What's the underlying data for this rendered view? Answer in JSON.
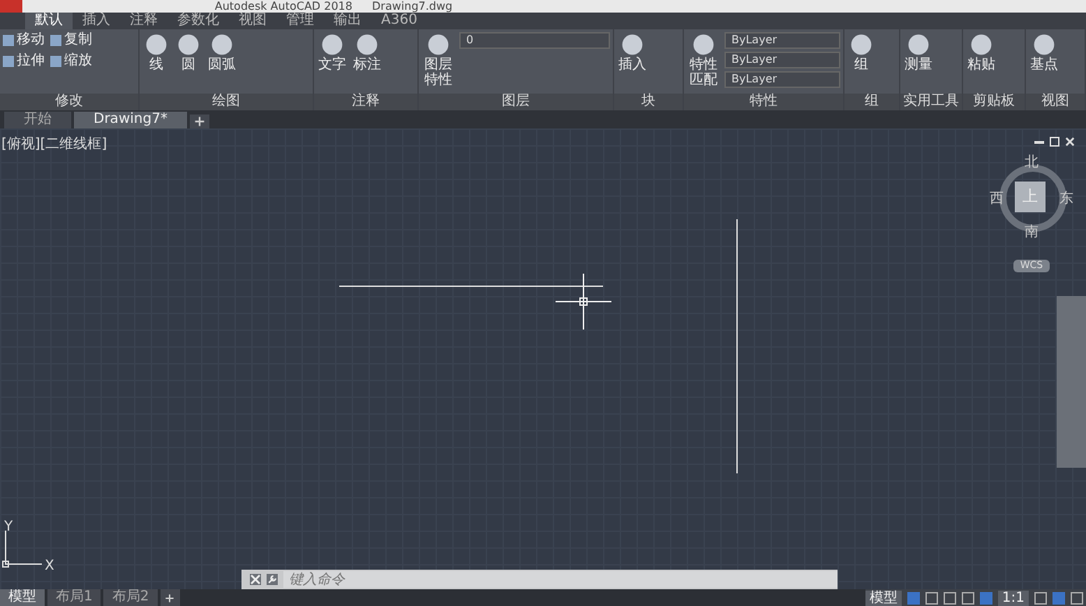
{
  "window": {
    "title": "Autodesk AutoCAD 2018",
    "document": "Drawing7.dwg"
  },
  "ribbon_tabs": [
    {
      "label": "默认",
      "selected": true
    },
    {
      "label": "插入",
      "selected": false
    },
    {
      "label": "注释",
      "selected": false
    },
    {
      "label": "参数化",
      "selected": false
    },
    {
      "label": "视图",
      "selected": false
    },
    {
      "label": "管理",
      "selected": false
    },
    {
      "label": "输出",
      "selected": false
    },
    {
      "label": "A360",
      "selected": false
    }
  ],
  "ribbon_panels": [
    {
      "title": "修改",
      "tools": [
        {
          "kind": "small",
          "label": "移动"
        },
        {
          "kind": "small",
          "label": "复制"
        },
        {
          "kind": "small",
          "label": "拉伸"
        },
        {
          "kind": "small",
          "label": "缩放"
        }
      ]
    },
    {
      "title": "绘图",
      "tools": [
        {
          "kind": "large",
          "label": "线"
        },
        {
          "kind": "large",
          "label": "圆"
        },
        {
          "kind": "large",
          "label": "圆弧"
        }
      ]
    },
    {
      "title": "注释",
      "tools": [
        {
          "kind": "large",
          "label": "文字"
        },
        {
          "kind": "large",
          "label": "标注"
        }
      ]
    },
    {
      "title": "图层",
      "tools": [
        {
          "kind": "large",
          "label": "图层特性"
        },
        {
          "kind": "dropdown",
          "label": "0"
        }
      ]
    },
    {
      "title": "块",
      "tools": [
        {
          "kind": "large",
          "label": "插入"
        }
      ]
    },
    {
      "title": "特性",
      "tools": [
        {
          "kind": "large",
          "label": "特性匹配"
        },
        {
          "kind": "dropdown",
          "label": "ByLayer"
        },
        {
          "kind": "dropdown",
          "label": "ByLayer"
        },
        {
          "kind": "dropdown",
          "label": "ByLayer"
        }
      ]
    },
    {
      "title": "组",
      "tools": [
        {
          "kind": "large",
          "label": "组"
        }
      ]
    },
    {
      "title": "实用工具",
      "tools": [
        {
          "kind": "large",
          "label": "测量"
        }
      ]
    },
    {
      "title": "剪贴板",
      "tools": [
        {
          "kind": "large",
          "label": "粘贴"
        }
      ]
    },
    {
      "title": "视图",
      "tools": [
        {
          "kind": "large",
          "label": "基点"
        }
      ]
    }
  ],
  "document_tabs": [
    {
      "label": "开始",
      "selected": false
    },
    {
      "label": "Drawing7*",
      "selected": true
    }
  ],
  "viewport": {
    "label": "[俯视][二维线框]"
  },
  "viewcube": {
    "north": "北",
    "south": "南",
    "east": "东",
    "west": "西",
    "face": "上",
    "ucs": "WCS"
  },
  "ucs_icon": {
    "x_label": "X",
    "y_label": "Y"
  },
  "command_line": {
    "placeholder": "键入命令"
  },
  "layout_tabs": [
    {
      "label": "模型",
      "selected": true
    },
    {
      "label": "布局1",
      "selected": false
    },
    {
      "label": "布局2",
      "selected": false
    }
  ],
  "status_bar": {
    "space": "模型",
    "scale": "1:1"
  }
}
